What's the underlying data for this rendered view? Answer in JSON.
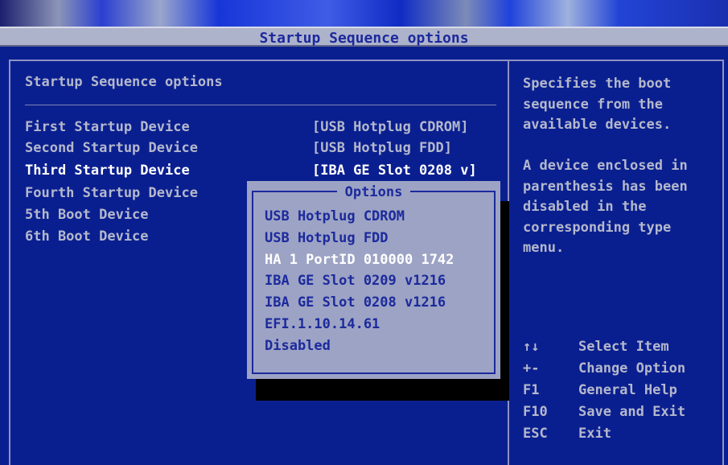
{
  "window": {
    "title": "Startup Sequence options"
  },
  "left_panel": {
    "heading": "Startup Sequence options",
    "rows": [
      {
        "label": "First Startup Device",
        "value": "[USB Hotplug CDROM]"
      },
      {
        "label": "Second Startup Device",
        "value": "[USB Hotplug FDD]"
      },
      {
        "label": "Third Startup Device",
        "value": "[IBA GE Slot 0208 v]"
      },
      {
        "label": "Fourth Startup Device",
        "value": ""
      },
      {
        "label": "5th Boot Device",
        "value": ""
      },
      {
        "label": "6th Boot Device",
        "value": ""
      }
    ]
  },
  "help_panel": {
    "description": "Specifies the boot\nsequence from the\navailable devices.\n\nA device enclosed in\nparenthesis has been\ndisabled in the\ncorresponding type\nmenu.",
    "keys": [
      {
        "key": "↑↓",
        "action": "Select Item"
      },
      {
        "key": "+-",
        "action": "Change Option"
      },
      {
        "key": "F1",
        "action": "General Help"
      },
      {
        "key": "F10",
        "action": "Save and Exit"
      },
      {
        "key": "ESC",
        "action": "Exit"
      }
    ]
  },
  "popup": {
    "title": "Options",
    "items": [
      "USB Hotplug CDROM",
      "USB Hotplug FDD",
      "HA 1 PortID 010000 1742",
      "IBA GE Slot 0209 v1216",
      "IBA GE Slot 0208 v1216",
      "EFI.1.10.14.61",
      "Disabled"
    ],
    "selected_index": 2
  },
  "colors": {
    "background": "#0a1f8f",
    "text": "#b4b8cc",
    "highlight": "#ffffff",
    "popup_bg": "#9da3c4",
    "popup_text": "#1c2a9c"
  }
}
